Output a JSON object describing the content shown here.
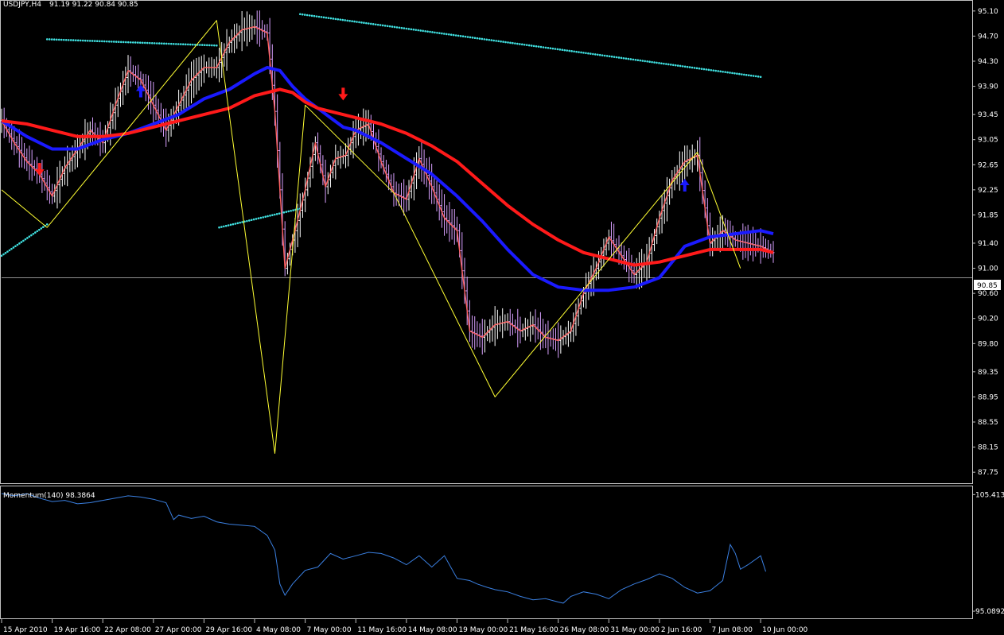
{
  "header": {
    "symbol": "USDJPY,H4",
    "ohlc": "91.19 91.22 90.84 90.85"
  },
  "colors": {
    "background": "#000000",
    "grid_border": "#c0c0c0",
    "text": "#ffffff",
    "ma_fast": "#ff6060",
    "ma_mid": "#1a1aff",
    "ma_slow": "#ff1a1a",
    "zigzag": "#ffff33",
    "trendline_dots": "#40e0e0",
    "bar_up": "#ffffff",
    "bar_down": "#d8a0ff",
    "momentum_line": "#3a7fe0",
    "price_line": "#c0c0c0",
    "arrow_up": "#1a1aff",
    "arrow_down": "#ff1a1a"
  },
  "chart_data": [
    {
      "type": "line",
      "symbol": "USDJPY",
      "timeframe": "H4",
      "last_price": "90.85",
      "ylim": [
        87.6,
        95.25
      ],
      "y_ticks": [
        "95.10",
        "94.70",
        "94.30",
        "93.90",
        "93.45",
        "93.05",
        "92.65",
        "92.25",
        "91.85",
        "91.40",
        "91.00",
        "90.60",
        "90.20",
        "89.80",
        "89.35",
        "88.95",
        "88.55",
        "88.15",
        "87.75"
      ],
      "x_ticks": [
        "15 Apr 2010",
        "19 Apr 16:00",
        "22 Apr 08:00",
        "27 Apr 00:00",
        "29 Apr 16:00",
        "4 May 08:00",
        "7 May 00:00",
        "11 May 16:00",
        "14 May 08:00",
        "19 May 00:00",
        "21 May 16:00",
        "26 May 08:00",
        "31 May 00:00",
        "2 Jun 16:00",
        "7 Jun 08:00",
        "10 Jun 00:00"
      ],
      "x_tick_index": [
        0,
        20,
        40,
        60,
        80,
        100,
        120,
        140,
        160,
        180,
        200,
        220,
        240,
        260,
        280,
        300
      ],
      "n_bars": 305,
      "series": [
        {
          "style": "thin",
          "color": "#ff6060",
          "x": [
            0,
            5,
            10,
            15,
            20,
            25,
            30,
            35,
            40,
            45,
            50,
            55,
            60,
            65,
            70,
            75,
            80,
            85,
            90,
            95,
            100,
            105,
            108,
            112,
            116,
            120,
            124,
            128,
            132,
            136,
            140,
            145,
            150,
            155,
            160,
            165,
            170,
            175,
            180,
            185,
            190,
            195,
            200,
            205,
            210,
            215,
            220,
            225,
            230,
            235,
            240,
            245,
            250,
            255,
            260,
            265,
            270,
            275,
            280,
            285,
            290,
            295,
            300,
            305
          ],
          "y": [
            93.35,
            93.0,
            92.7,
            92.5,
            92.15,
            92.6,
            92.9,
            93.2,
            93.0,
            93.6,
            94.15,
            94.0,
            93.6,
            93.2,
            93.6,
            94.0,
            94.2,
            94.2,
            94.6,
            94.8,
            94.85,
            94.75,
            93.5,
            91.0,
            91.6,
            92.25,
            93.0,
            92.3,
            92.75,
            92.8,
            93.2,
            93.3,
            92.7,
            92.2,
            92.1,
            92.75,
            92.3,
            91.8,
            91.6,
            90.0,
            89.9,
            90.1,
            90.15,
            90.0,
            90.1,
            89.9,
            89.85,
            90.0,
            90.6,
            91.0,
            91.5,
            91.2,
            90.9,
            91.1,
            91.8,
            92.4,
            92.7,
            92.8,
            91.4,
            91.6,
            91.45,
            91.4,
            91.35,
            91.25
          ]
        },
        {
          "style": "thick",
          "color": "#1a1aff",
          "x": [
            0,
            10,
            20,
            30,
            40,
            50,
            60,
            70,
            80,
            90,
            100,
            105,
            110,
            115,
            120,
            125,
            130,
            135,
            140,
            145,
            150,
            160,
            170,
            180,
            190,
            200,
            210,
            220,
            230,
            240,
            250,
            260,
            265,
            270,
            280,
            290,
            300,
            305
          ],
          "y": [
            93.35,
            93.1,
            92.9,
            92.9,
            93.05,
            93.15,
            93.3,
            93.45,
            93.7,
            93.85,
            94.1,
            94.2,
            94.15,
            93.9,
            93.7,
            93.55,
            93.4,
            93.25,
            93.2,
            93.1,
            93.0,
            92.75,
            92.5,
            92.15,
            91.75,
            91.3,
            90.9,
            90.7,
            90.65,
            90.65,
            90.7,
            90.85,
            91.1,
            91.35,
            91.5,
            91.55,
            91.6,
            91.55
          ]
        },
        {
          "style": "thick",
          "color": "#ff1a1a",
          "x": [
            0,
            10,
            20,
            30,
            40,
            50,
            60,
            70,
            80,
            90,
            100,
            110,
            115,
            120,
            125,
            130,
            140,
            150,
            160,
            170,
            180,
            190,
            200,
            210,
            220,
            230,
            240,
            250,
            260,
            270,
            280,
            290,
            300,
            305
          ],
          "y": [
            93.35,
            93.3,
            93.2,
            93.1,
            93.1,
            93.15,
            93.25,
            93.35,
            93.45,
            93.55,
            93.75,
            93.85,
            93.8,
            93.65,
            93.55,
            93.5,
            93.4,
            93.3,
            93.15,
            92.95,
            92.7,
            92.35,
            92.0,
            91.7,
            91.45,
            91.25,
            91.15,
            91.05,
            91.1,
            91.2,
            91.3,
            91.3,
            91.3,
            91.25
          ]
        },
        {
          "style": "zigzag",
          "color": "#ffff33",
          "x": [
            0,
            18,
            85,
            108,
            120,
            155,
            195,
            275,
            292
          ],
          "y": [
            92.25,
            91.65,
            94.95,
            88.05,
            93.6,
            92.2,
            88.95,
            92.85,
            91.0
          ]
        }
      ],
      "trendline_dots": [
        {
          "x": [
            0,
            18
          ],
          "y": [
            91.2,
            91.7
          ]
        },
        {
          "x": [
            18,
            85
          ],
          "y": [
            94.65,
            94.55
          ]
        },
        {
          "x": [
            86,
            118
          ],
          "y": [
            91.65,
            91.95
          ]
        },
        {
          "x": [
            118,
            300
          ],
          "y": [
            95.05,
            94.05
          ]
        }
      ],
      "arrows": [
        {
          "dir": "down",
          "x": 15,
          "y": 92.55
        },
        {
          "dir": "up",
          "x": 55,
          "y": 93.85
        },
        {
          "dir": "down",
          "x": 135,
          "y": 93.75
        },
        {
          "dir": "up",
          "x": 270,
          "y": 92.35
        }
      ]
    },
    {
      "type": "line",
      "title": "Momentum(140) 98.3864",
      "ylim": [
        94.6,
        106.0
      ],
      "y_ticks": [
        "105.413",
        "95.0892"
      ],
      "series": [
        {
          "color": "#3a7fe0",
          "x": [
            0,
            5,
            10,
            15,
            20,
            25,
            30,
            35,
            40,
            45,
            50,
            55,
            60,
            65,
            68,
            70,
            75,
            80,
            85,
            90,
            95,
            100,
            105,
            108,
            110,
            112,
            115,
            120,
            125,
            130,
            135,
            140,
            145,
            150,
            155,
            160,
            165,
            170,
            175,
            180,
            185,
            188,
            192,
            195,
            200,
            205,
            210,
            215,
            220,
            222,
            225,
            230,
            235,
            240,
            245,
            250,
            255,
            260,
            265,
            270,
            275,
            280,
            285,
            288,
            290,
            292,
            295,
            300,
            302
          ],
          "y": [
            105.5,
            105.3,
            105.5,
            105.1,
            104.8,
            104.9,
            104.6,
            104.7,
            104.9,
            105.1,
            105.3,
            105.2,
            105.0,
            104.7,
            103.2,
            103.6,
            103.3,
            103.5,
            103.0,
            102.8,
            102.7,
            102.6,
            101.8,
            100.5,
            97.5,
            96.5,
            97.5,
            98.7,
            99.0,
            100.2,
            99.7,
            100.0,
            100.3,
            100.2,
            99.8,
            99.2,
            100.0,
            99.0,
            100.0,
            98.0,
            97.8,
            97.5,
            97.2,
            97.0,
            96.8,
            96.4,
            96.1,
            96.2,
            95.9,
            95.8,
            96.4,
            96.8,
            96.6,
            96.2,
            97.0,
            97.5,
            97.9,
            98.4,
            98.0,
            97.2,
            96.7,
            96.9,
            97.8,
            101.0,
            100.2,
            98.8,
            99.2,
            100.0,
            98.6
          ]
        }
      ]
    }
  ]
}
